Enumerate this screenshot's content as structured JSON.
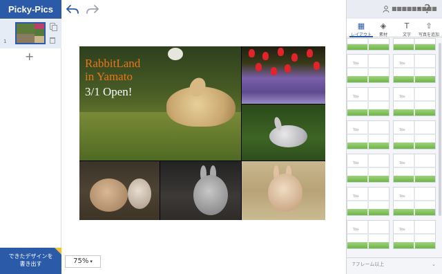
{
  "app": {
    "title": "Picky-Pics"
  },
  "pages": [
    {
      "number": "1"
    }
  ],
  "add_page_label": "+",
  "export_button": {
    "line1": "できたデザインを",
    "line2": "書き出す"
  },
  "zoom": {
    "value": "75%",
    "caret": "▾"
  },
  "canvas": {
    "headline_line1": "RabbitLand",
    "headline_line2": "in Yamato",
    "headline_line3": "3/1 Open!",
    "accent_color": "#e8751a"
  },
  "header": {
    "user_name": "■■■■■■■■■",
    "user_caret": "▾",
    "help_label": "?"
  },
  "tabs": [
    {
      "label": "レイアウト",
      "icon": "layout-icon",
      "glyph": "▦"
    },
    {
      "label": "素材",
      "icon": "shapes-icon",
      "glyph": "◈"
    },
    {
      "label": "文字",
      "icon": "text-icon",
      "glyph": "T"
    },
    {
      "label": "写真を追加",
      "icon": "upload-icon",
      "glyph": "⇧"
    }
  ],
  "layout_title_text": "Title",
  "frames_filter": {
    "label": "7フレーム以上",
    "caret": "⌄"
  },
  "colors": {
    "brand": "#2a5aa8",
    "export_corner": "#f1c232",
    "panel_bg": "#f3f5f8"
  }
}
